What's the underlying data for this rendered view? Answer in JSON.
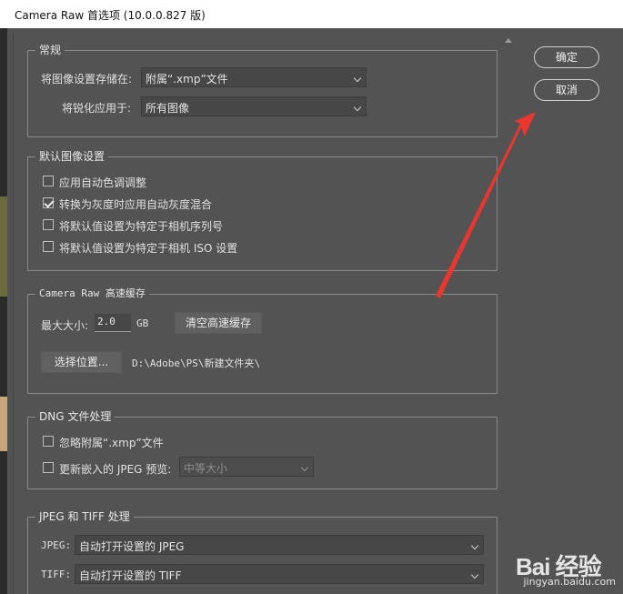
{
  "window": {
    "title": "Camera Raw 首选项 (10.0.0.827 版)"
  },
  "buttons": {
    "ok": "确定",
    "cancel": "取消"
  },
  "general": {
    "legend": "常规",
    "save_settings_label": "将图像设置存储在:",
    "save_settings_value": "附属“.xmp”文件",
    "sharpen_label": "将锐化应用于:",
    "sharpen_value": "所有图像"
  },
  "defaults": {
    "legend": "默认图像设置",
    "options": [
      {
        "label": "应用自动色调调整",
        "checked": false
      },
      {
        "label": "转换为灰度时应用自动灰度混合",
        "checked": true
      },
      {
        "label": "将默认值设置为特定于相机序列号",
        "checked": false
      },
      {
        "label": "将默认值设置为特定于相机 ISO 设置",
        "checked": false
      }
    ]
  },
  "cache": {
    "legend": "Camera Raw 高速缓存",
    "max_size_label": "最大大小:",
    "max_size_value": "2.0",
    "unit": "GB",
    "purge_button": "清空高速缓存",
    "location_button": "选择位置...",
    "location_path": "D:\\Adobe\\PS\\新建文件夹\\"
  },
  "dng": {
    "legend": "DNG 文件处理",
    "ignore_sidecar_label": "忽略附属“.xmp”文件",
    "ignore_sidecar_checked": false,
    "update_preview_label": "更新嵌入的 JPEG 预览:",
    "update_preview_checked": false,
    "preview_size_value": "中等大小"
  },
  "jpeg_tiff": {
    "legend": "JPEG 和 TIFF 处理",
    "jpeg_label": "JPEG:",
    "jpeg_value": "自动打开设置的 JPEG",
    "tiff_label": "TIFF:",
    "tiff_value": "自动打开设置的 TIFF"
  },
  "watermark": {
    "logo": "Bai 经验",
    "url": "jingyan.baidu.com"
  },
  "annotation": {
    "arrow_color": "#e8372f"
  }
}
